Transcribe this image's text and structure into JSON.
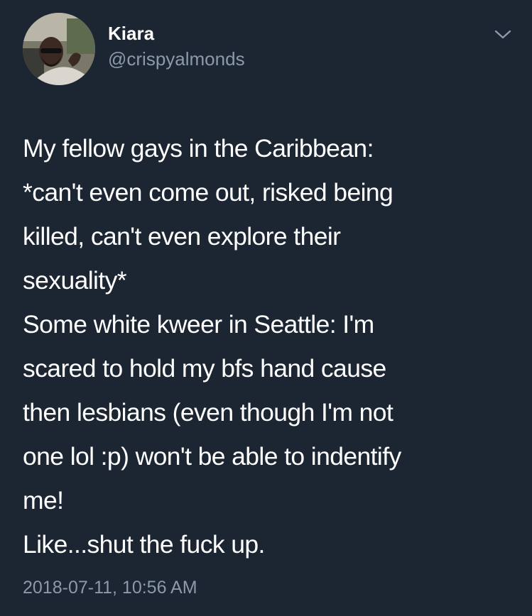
{
  "user": {
    "display_name": "Kiara",
    "handle": "@crispyalmonds"
  },
  "tweet": {
    "lines": [
      "My fellow gays in the Caribbean:",
      "*can't even come out, risked being",
      "killed, can't even explore their",
      "sexuality*",
      "Some white kweer in Seattle: I'm",
      "scared to hold my bfs hand cause",
      "then lesbians (even though I'm not",
      "one lol :p) won't be able to indentify",
      "me!",
      "Like...shut the fuck up."
    ],
    "timestamp": "2018-07-11, 10:56 AM"
  },
  "icons": {
    "menu": "chevron-down-icon",
    "avatar": "profile-photo"
  },
  "colors": {
    "background": "#1c2532",
    "primary_text": "#ffffff",
    "secondary_text": "#8a9aab"
  }
}
